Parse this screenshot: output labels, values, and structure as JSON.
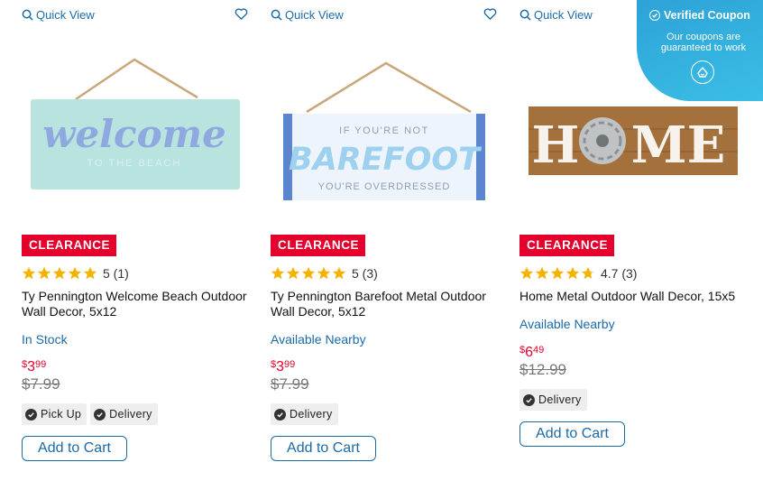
{
  "quick_view_label": "Quick View",
  "products": [
    {
      "badge": "CLEARANCE",
      "rating": "5 (1)",
      "title": "Ty Pennington Welcome Beach Outdoor Wall Decor, 5x12",
      "availability": "In Stock",
      "price_currency": "$",
      "price_dollars": "3",
      "price_cents": "99",
      "old_price": "$7.99",
      "chips": [
        "Pick Up",
        "Delivery"
      ],
      "cart_label": "Add to Cart",
      "image_text_main": "welcome",
      "image_text_sub": "TO THE BEACH"
    },
    {
      "badge": "CLEARANCE",
      "rating": "5 (3)",
      "title": "Ty Pennington Barefoot Metal Outdoor Wall Decor, 5x12",
      "availability": "Available Nearby",
      "price_currency": "$",
      "price_dollars": "3",
      "price_cents": "99",
      "old_price": "$7.99",
      "chips": [
        "Delivery"
      ],
      "cart_label": "Add to Cart",
      "image_text_top": "IF YOU'RE NOT",
      "image_text_main": "BAREFOOT",
      "image_text_sub": "YOU'RE OVERDRESSED"
    },
    {
      "badge": "CLEARANCE",
      "rating": "4.7 (3)",
      "title": "Home Metal Outdoor Wall Decor, 15x5",
      "availability": "Available Nearby",
      "price_currency": "$",
      "price_dollars": "6",
      "price_cents": "49",
      "old_price": "$12.99",
      "chips": [
        "Delivery"
      ],
      "cart_label": "Add to Cart",
      "image_text_h": "H",
      "image_text_me": "ME"
    }
  ],
  "coupon": {
    "title": "Verified Coupon",
    "subtitle": "Our coupons are guaranteed to work"
  },
  "colors": {
    "accent_blue": "#1a6aa8",
    "clearance_red": "#e4002b",
    "star_gold": "#f5b301"
  }
}
